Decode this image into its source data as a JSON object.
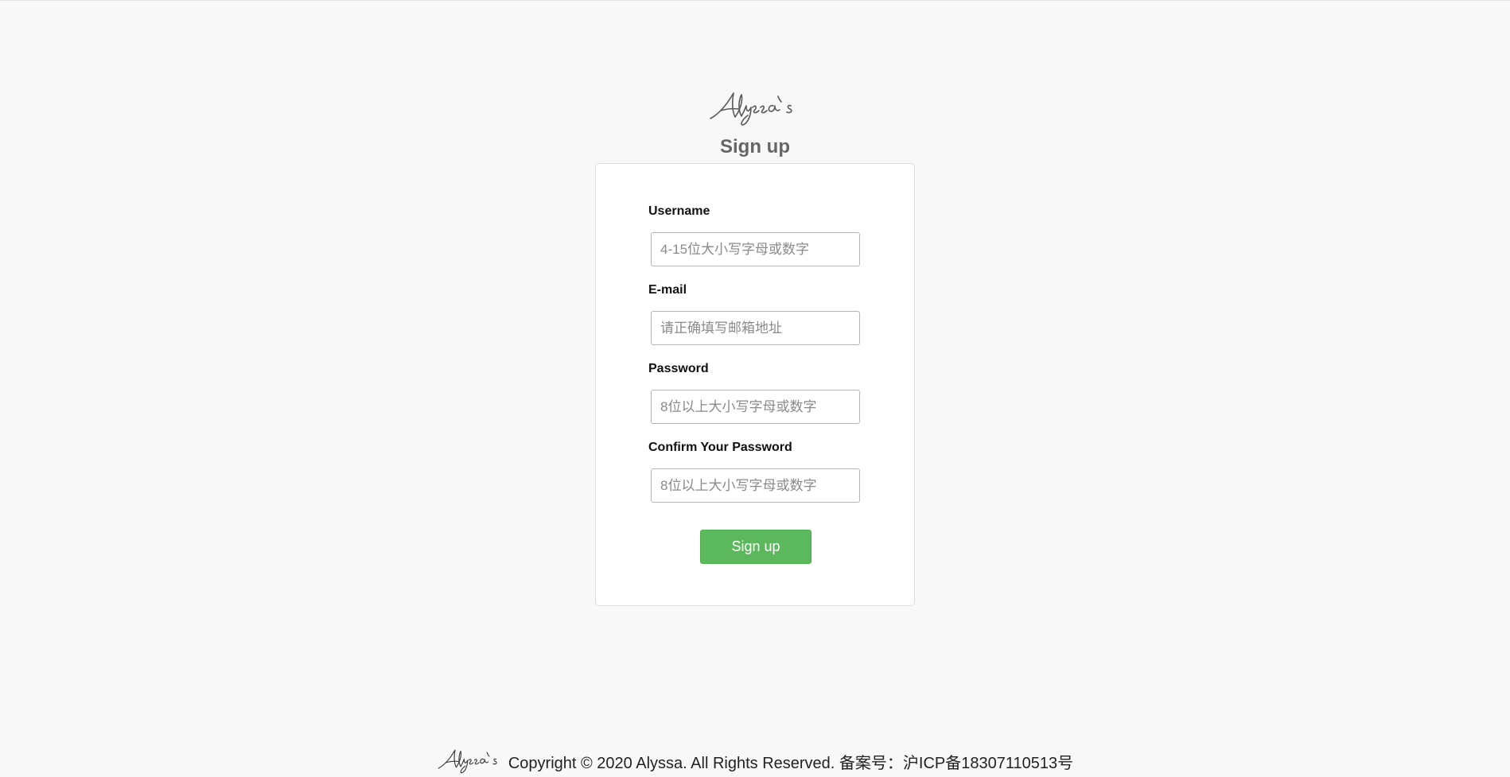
{
  "brand": {
    "logo_text": "Alyssa's"
  },
  "page": {
    "title": "Sign up"
  },
  "form": {
    "fields": [
      {
        "label": "Username",
        "placeholder": "4-15位大小写字母或数字",
        "value": "",
        "type": "text"
      },
      {
        "label": "E-mail",
        "placeholder": "请正确填写邮箱地址",
        "value": "",
        "type": "email"
      },
      {
        "label": "Password",
        "placeholder": "8位以上大小写字母或数字",
        "value": "",
        "type": "password"
      },
      {
        "label": "Confirm Your Password",
        "placeholder": "8位以上大小写字母或数字",
        "value": "",
        "type": "password"
      }
    ],
    "submit_label": "Sign up",
    "submit_color": "#5cb85c"
  },
  "footer": {
    "text": "Copyright © 2020 Alyssa. All Rights Reserved. 备案号：沪ICP备18307110513号"
  }
}
